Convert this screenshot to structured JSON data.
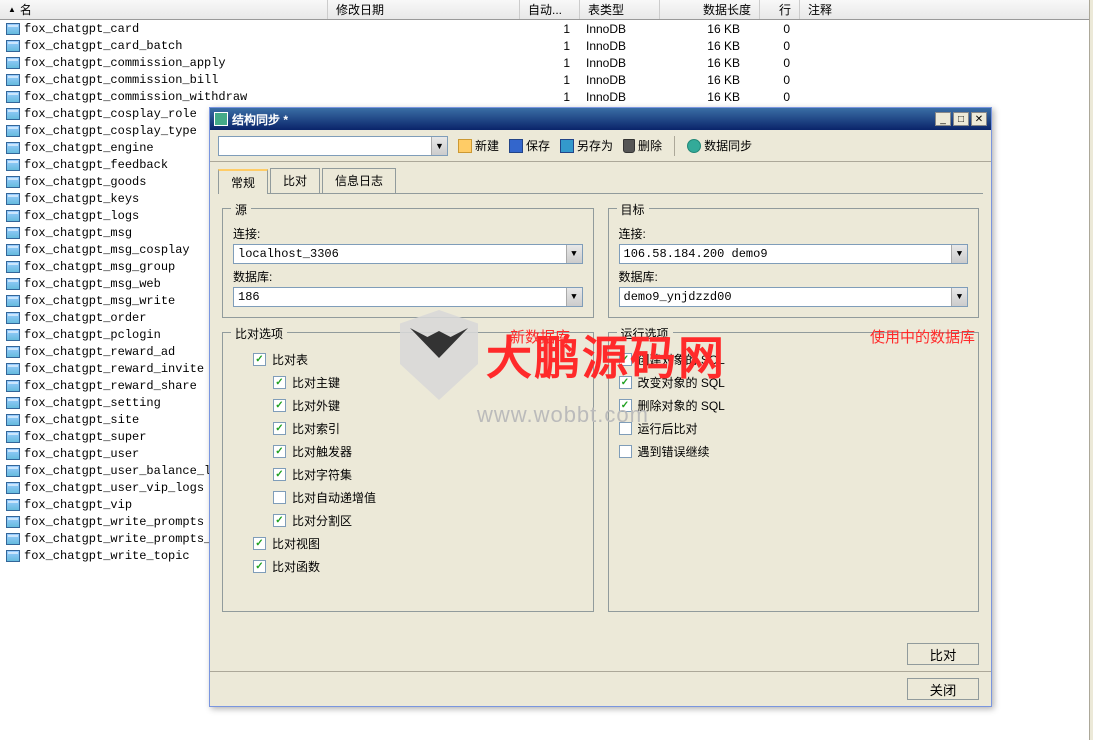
{
  "table": {
    "headers": {
      "name": "名",
      "date": "修改日期",
      "auto": "自动...",
      "type": "表类型",
      "len": "数据长度",
      "rows": "行",
      "comment": "注释"
    },
    "rows": [
      {
        "name": "fox_chatgpt_card",
        "auto": "1",
        "type": "InnoDB",
        "len": "16 KB",
        "rows": "0"
      },
      {
        "name": "fox_chatgpt_card_batch",
        "auto": "1",
        "type": "InnoDB",
        "len": "16 KB",
        "rows": "0"
      },
      {
        "name": "fox_chatgpt_commission_apply",
        "auto": "1",
        "type": "InnoDB",
        "len": "16 KB",
        "rows": "0"
      },
      {
        "name": "fox_chatgpt_commission_bill",
        "auto": "1",
        "type": "InnoDB",
        "len": "16 KB",
        "rows": "0"
      },
      {
        "name": "fox_chatgpt_commission_withdraw",
        "auto": "1",
        "type": "InnoDB",
        "len": "16 KB",
        "rows": "0"
      },
      {
        "name": "fox_chatgpt_cosplay_role",
        "auto": "",
        "type": "",
        "len": "",
        "rows": ""
      },
      {
        "name": "fox_chatgpt_cosplay_type",
        "auto": "",
        "type": "",
        "len": "",
        "rows": ""
      },
      {
        "name": "fox_chatgpt_engine",
        "auto": "",
        "type": "",
        "len": "",
        "rows": ""
      },
      {
        "name": "fox_chatgpt_feedback",
        "auto": "",
        "type": "",
        "len": "",
        "rows": ""
      },
      {
        "name": "fox_chatgpt_goods",
        "auto": "",
        "type": "",
        "len": "",
        "rows": ""
      },
      {
        "name": "fox_chatgpt_keys",
        "auto": "",
        "type": "",
        "len": "",
        "rows": ""
      },
      {
        "name": "fox_chatgpt_logs",
        "auto": "",
        "type": "",
        "len": "",
        "rows": ""
      },
      {
        "name": "fox_chatgpt_msg",
        "auto": "",
        "type": "",
        "len": "",
        "rows": ""
      },
      {
        "name": "fox_chatgpt_msg_cosplay",
        "auto": "",
        "type": "",
        "len": "",
        "rows": ""
      },
      {
        "name": "fox_chatgpt_msg_group",
        "auto": "",
        "type": "",
        "len": "",
        "rows": ""
      },
      {
        "name": "fox_chatgpt_msg_web",
        "auto": "",
        "type": "",
        "len": "",
        "rows": ""
      },
      {
        "name": "fox_chatgpt_msg_write",
        "auto": "",
        "type": "",
        "len": "",
        "rows": ""
      },
      {
        "name": "fox_chatgpt_order",
        "auto": "",
        "type": "",
        "len": "",
        "rows": ""
      },
      {
        "name": "fox_chatgpt_pclogin",
        "auto": "",
        "type": "",
        "len": "",
        "rows": ""
      },
      {
        "name": "fox_chatgpt_reward_ad",
        "auto": "",
        "type": "",
        "len": "",
        "rows": ""
      },
      {
        "name": "fox_chatgpt_reward_invite",
        "auto": "",
        "type": "",
        "len": "",
        "rows": ""
      },
      {
        "name": "fox_chatgpt_reward_share",
        "auto": "",
        "type": "",
        "len": "",
        "rows": ""
      },
      {
        "name": "fox_chatgpt_setting",
        "auto": "",
        "type": "",
        "len": "",
        "rows": ""
      },
      {
        "name": "fox_chatgpt_site",
        "auto": "",
        "type": "",
        "len": "",
        "rows": ""
      },
      {
        "name": "fox_chatgpt_super",
        "auto": "",
        "type": "",
        "len": "",
        "rows": ""
      },
      {
        "name": "fox_chatgpt_user",
        "auto": "",
        "type": "",
        "len": "",
        "rows": ""
      },
      {
        "name": "fox_chatgpt_user_balance_logs",
        "auto": "",
        "type": "",
        "len": "",
        "rows": ""
      },
      {
        "name": "fox_chatgpt_user_vip_logs",
        "auto": "",
        "type": "",
        "len": "",
        "rows": ""
      },
      {
        "name": "fox_chatgpt_vip",
        "auto": "",
        "type": "",
        "len": "",
        "rows": ""
      },
      {
        "name": "fox_chatgpt_write_prompts",
        "auto": "",
        "type": "",
        "len": "",
        "rows": ""
      },
      {
        "name": "fox_chatgpt_write_prompts_vars",
        "auto": "",
        "type": "",
        "len": "",
        "rows": ""
      },
      {
        "name": "fox_chatgpt_write_topic",
        "auto": "",
        "type": "",
        "len": "",
        "rows": ""
      }
    ]
  },
  "dialog": {
    "title": "结构同步 *",
    "toolbar": {
      "new": "新建",
      "save": "保存",
      "saveas": "另存为",
      "delete": "删除",
      "sync": "数据同步"
    },
    "tabs": {
      "general": "常规",
      "compare": "比对",
      "log": "信息日志"
    },
    "source": {
      "legend": "源",
      "conn_label": "连接:",
      "conn_value": "localhost_3306",
      "db_label": "数据库:",
      "db_value": "186"
    },
    "target": {
      "legend": "目标",
      "conn_label": "连接:",
      "conn_value": "106.58.184.200 demo9",
      "db_label": "数据库:",
      "db_value": "demo9_ynjdzzd00"
    },
    "compare_opts": {
      "legend": "比对选项",
      "compare_table": "比对表",
      "compare_pk": "比对主键",
      "compare_fk": "比对外键",
      "compare_index": "比对索引",
      "compare_trigger": "比对触发器",
      "compare_charset": "比对字符集",
      "compare_autoinc": "比对自动递增值",
      "compare_partition": "比对分割区",
      "compare_view": "比对视图",
      "compare_func": "比对函数"
    },
    "run_opts": {
      "legend": "运行选项",
      "create_sql": "创建对象的 SQL",
      "alter_sql": "改变对象的 SQL",
      "drop_sql": "删除对象的 SQL",
      "run_after": "运行后比对",
      "continue_err": "遇到错误继续"
    },
    "buttons": {
      "compare": "比对",
      "close": "关闭"
    }
  },
  "annotations": {
    "new_db": "新数据库",
    "in_use_db": "使用中的数据库"
  },
  "watermark": {
    "text": "大鹏源码网",
    "url": "www.wobbt.com"
  }
}
